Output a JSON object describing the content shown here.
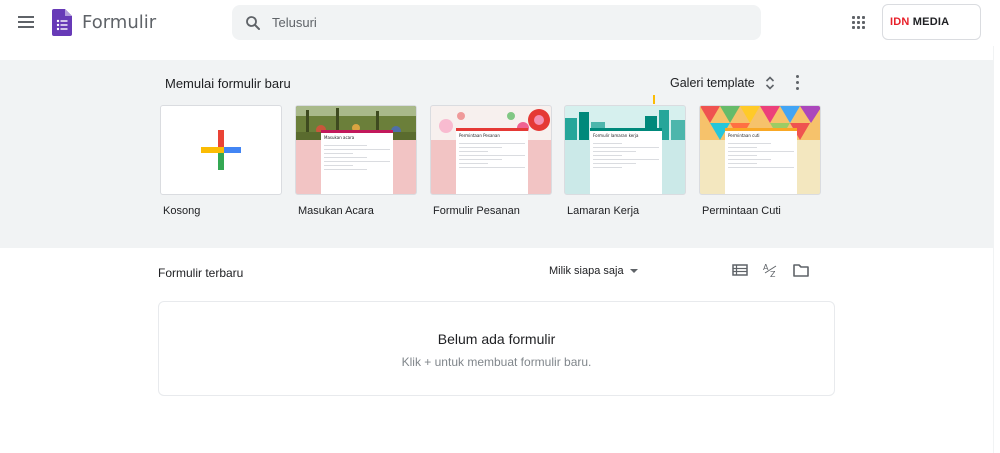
{
  "app": {
    "title": "Formulir"
  },
  "search": {
    "placeholder": "Telusuri"
  },
  "account": {
    "brand_a": "IDN",
    "brand_b": " MEDIA"
  },
  "templates_section": {
    "heading": "Memulai formulir baru",
    "gallery_label": "Galeri template",
    "items": [
      {
        "name": "Kosong"
      },
      {
        "name": "Masukan Acara",
        "doc_title": "Masukan acara"
      },
      {
        "name": "Formulir Pesanan",
        "doc_title": "Permintaan Pesanan"
      },
      {
        "name": "Lamaran Kerja",
        "doc_title": "Formulir lamaran kerja"
      },
      {
        "name": "Permintaan Cuti",
        "doc_title": "Permintaan cuti"
      }
    ]
  },
  "recent": {
    "heading": "Formulir terbaru",
    "owner_filter": "Milik siapa saja",
    "empty_title": "Belum ada formulir",
    "empty_subtitle": "Klik + untuk membuat formulir baru."
  },
  "colors": {
    "forms_purple": "#673ab7",
    "section_bg": "#f1f3f4",
    "pink": "#f2c4c4",
    "teal": "#cbe9e8",
    "beige": "#f3e7bf",
    "brand_red": "#e8202a"
  },
  "icons": {
    "menu": "menu-icon",
    "search": "search-icon",
    "apps": "apps-grid-icon",
    "unfold": "unfold-more-icon",
    "more": "more-vert-icon",
    "list_view": "list-view-icon",
    "sort": "sort-az-icon",
    "folder": "folder-icon"
  }
}
